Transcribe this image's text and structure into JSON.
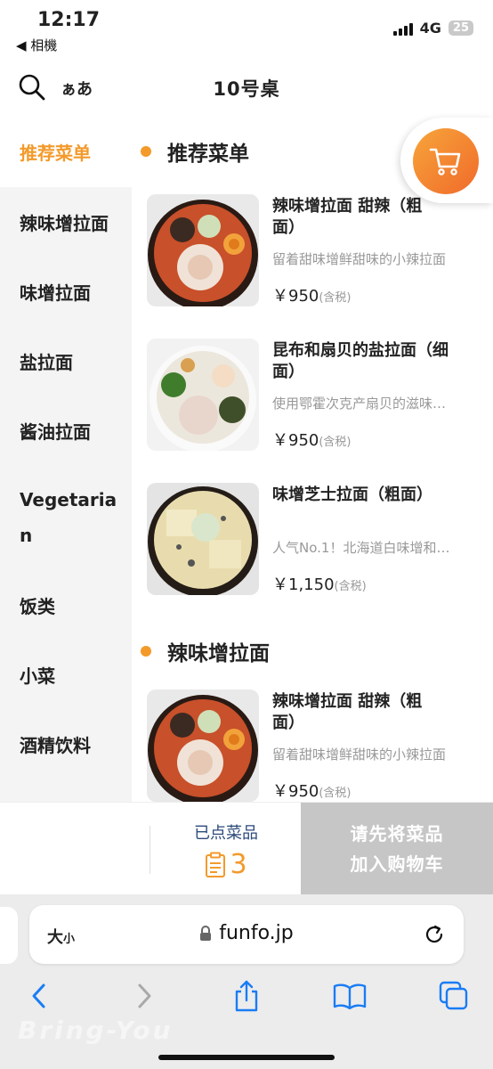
{
  "status": {
    "time": "12:17",
    "back_label": "◀ 相機",
    "network": "4G",
    "battery": "25"
  },
  "header": {
    "lang_toggle": "ぁあ",
    "title": "10号桌"
  },
  "sidebar": {
    "items": [
      {
        "label": "推荐菜单"
      },
      {
        "label": "辣味增拉面"
      },
      {
        "label": "味增拉面"
      },
      {
        "label": "盐拉面"
      },
      {
        "label": "酱油拉面"
      },
      {
        "label": "Vegetarian"
      },
      {
        "label": "饭类"
      },
      {
        "label": "小菜"
      },
      {
        "label": "酒精饮料"
      }
    ]
  },
  "sections": [
    {
      "title": "推荐菜单",
      "items": [
        {
          "name_line1": "辣味增拉面 甜辣（粗",
          "name_line2": "面）",
          "desc": "留着甜味增鲜甜味的小辣拉面",
          "price": "￥950",
          "tax": "(含税)"
        },
        {
          "name_line1": "昆布和扇贝的盐拉面（细",
          "name_line2": "面）",
          "desc": "使用鄂霍次克产扇贝的滋味…",
          "price": "￥950",
          "tax": "(含税)"
        },
        {
          "name_line1": "味增芝士拉面（粗面）",
          "name_line2": "",
          "desc": "人气No.1！北海道白味增和…",
          "price": "￥1,150",
          "tax": "(含税)"
        }
      ]
    },
    {
      "title": "辣味增拉面",
      "items": [
        {
          "name_line1": "辣味增拉面 甜辣（粗",
          "name_line2": "面）",
          "desc": "留着甜味增鲜甜味的小辣拉面",
          "price": "￥950",
          "tax": "(含税)"
        }
      ]
    }
  ],
  "orderbar": {
    "ordered_label": "已点菜品",
    "ordered_count": "3",
    "checkout_line1": "请先将菜品",
    "checkout_line2": "加入购物车"
  },
  "browser": {
    "text_size": "大",
    "text_size_small": "小",
    "url": "funfo.jp"
  },
  "watermark": "Bring-You",
  "colors": {
    "accent": "#f39a2b",
    "cart_gradient_start": "#f7a53b",
    "cart_gradient_end": "#f06a2a",
    "checkout_disabled": "#c6c6c6"
  }
}
